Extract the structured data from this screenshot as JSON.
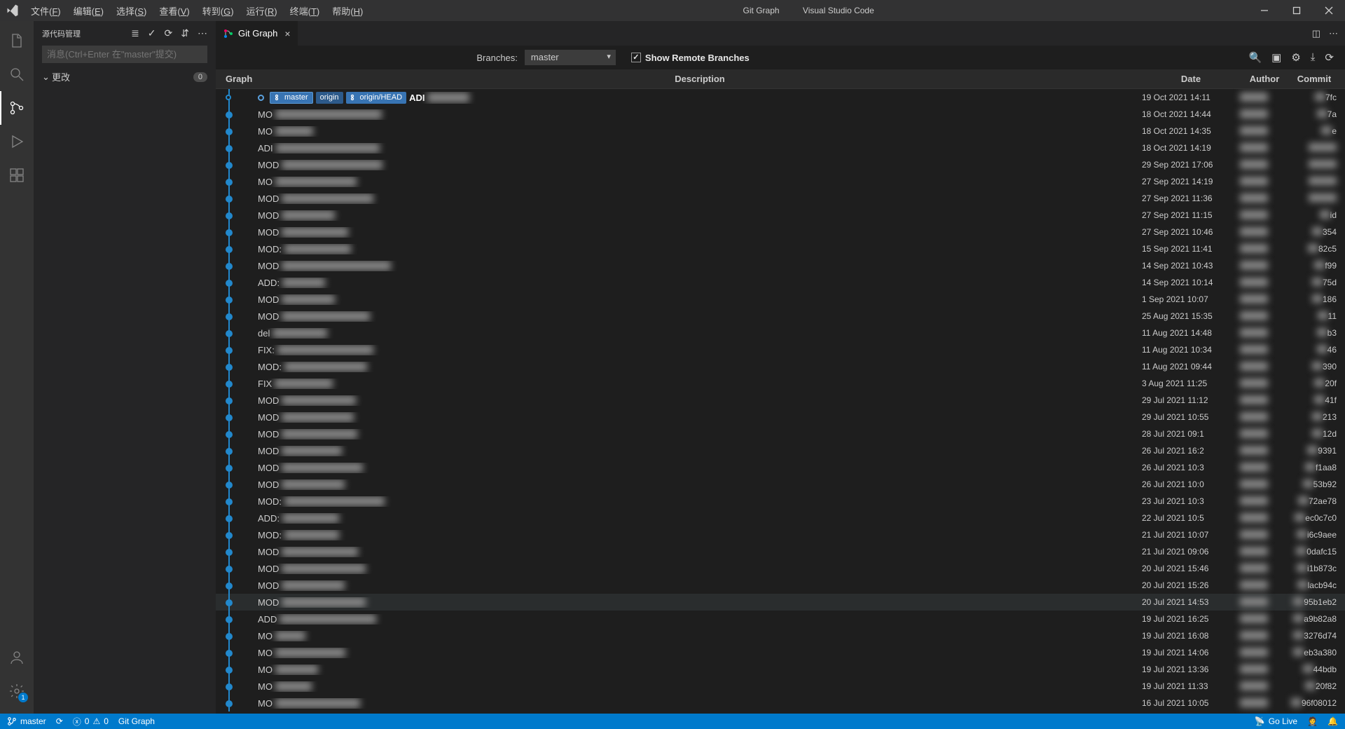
{
  "title": {
    "center": "Git Graph",
    "app": "Visual Studio Code"
  },
  "menu": [
    {
      "label": "文件",
      "key": "F"
    },
    {
      "label": "编辑",
      "key": "E"
    },
    {
      "label": "选择",
      "key": "S"
    },
    {
      "label": "查看",
      "key": "V"
    },
    {
      "label": "转到",
      "key": "G"
    },
    {
      "label": "运行",
      "key": "R"
    },
    {
      "label": "终端",
      "key": "T"
    },
    {
      "label": "帮助",
      "key": "H"
    }
  ],
  "sidebar": {
    "title": "源代码管理",
    "commit_placeholder": "消息(Ctrl+Enter 在\"master\"提交)",
    "changes_label": "更改",
    "changes_count": "0"
  },
  "tab": {
    "label": "Git Graph"
  },
  "toolbar": {
    "branches_label": "Branches:",
    "branch_value": "master",
    "show_remote": "Show Remote Branches",
    "show_remote_checked": true
  },
  "columns": {
    "graph": "Graph",
    "description": "Description",
    "date": "Date",
    "author": "Author",
    "commit": "Commit"
  },
  "refs": {
    "master": "master",
    "origin": "origin",
    "origin_head": "origin/HEAD"
  },
  "commits": [
    {
      "msg": "ADI",
      "bold": true,
      "date": "19 Oct 2021 14:11",
      "commit": "7fc",
      "head": true,
      "hollow": true
    },
    {
      "msg": "MO",
      "date": "18 Oct 2021 14:44",
      "commit": "7a"
    },
    {
      "msg": "MO",
      "date": "18 Oct 2021 14:35",
      "commit": "e"
    },
    {
      "msg": "ADI",
      "date": "18 Oct 2021 14:19",
      "commit": ""
    },
    {
      "msg": "MOD",
      "date": "29 Sep 2021 17:06",
      "commit": ""
    },
    {
      "msg": "MO",
      "date": "27 Sep 2021 14:19",
      "commit": ""
    },
    {
      "msg": "MOD",
      "date": "27 Sep 2021 11:36",
      "commit": ""
    },
    {
      "msg": "MOD",
      "date": "27 Sep 2021 11:15",
      "commit": "id"
    },
    {
      "msg": "MOD",
      "date": "27 Sep 2021 10:46",
      "commit": "354"
    },
    {
      "msg": "MOD:",
      "date": "15 Sep 2021 11:41",
      "commit": "82c5"
    },
    {
      "msg": "MOD",
      "date": "14 Sep 2021 10:43",
      "commit": "f99"
    },
    {
      "msg": "ADD:",
      "date": "14 Sep 2021 10:14",
      "commit": "75d"
    },
    {
      "msg": "MOD",
      "date": "1 Sep 2021 10:07",
      "commit": "186"
    },
    {
      "msg": "MOD",
      "date": "25 Aug 2021 15:35",
      "commit": "11"
    },
    {
      "msg": "del",
      "date": "11 Aug 2021 14:48",
      "commit": "b3"
    },
    {
      "msg": "FIX:",
      "date": "11 Aug 2021 10:34",
      "commit": "46"
    },
    {
      "msg": "MOD:",
      "date": "11 Aug 2021 09:44",
      "commit": "390"
    },
    {
      "msg": "FIX",
      "date": "3 Aug 2021 11:25",
      "commit": "20f"
    },
    {
      "msg": "MOD",
      "date": "29 Jul 2021 11:12",
      "commit": "41f"
    },
    {
      "msg": "MOD",
      "date": "29 Jul 2021 10:55",
      "commit": "213"
    },
    {
      "msg": "MOD",
      "date": "28 Jul 2021 09:1",
      "commit": "12d"
    },
    {
      "msg": "MOD",
      "date": "26 Jul 2021 16:2",
      "commit": "9391"
    },
    {
      "msg": "MOD",
      "date": "26 Jul 2021 10:3",
      "commit": "f1aa8"
    },
    {
      "msg": "MOD",
      "date": "26 Jul 2021 10:0",
      "commit": "53b92"
    },
    {
      "msg": "MOD:",
      "date": "23 Jul 2021 10:3",
      "commit": "72ae78"
    },
    {
      "msg": "ADD:",
      "date": "22 Jul 2021 10:5",
      "commit": "ec0c7c0"
    },
    {
      "msg": "MOD:",
      "date": "21 Jul 2021 10:07",
      "commit": "i6c9aee"
    },
    {
      "msg": "MOD",
      "date": "21 Jul 2021 09:06",
      "commit": "0dafc15"
    },
    {
      "msg": "MOD",
      "date": "20 Jul 2021 15:46",
      "commit": "i1b873c"
    },
    {
      "msg": "MOD",
      "date": "20 Jul 2021 15:26",
      "commit": "lacb94c"
    },
    {
      "msg": "MOD",
      "date": "20 Jul 2021 14:53",
      "commit": "95b1eb2",
      "hovered": true
    },
    {
      "msg": "ADD",
      "date": "19 Jul 2021 16:25",
      "commit": "a9b82a8"
    },
    {
      "msg": "MO",
      "date": "19 Jul 2021 16:08",
      "commit": "3276d74"
    },
    {
      "msg": "MO",
      "date": "19 Jul 2021 14:06",
      "commit": "eb3a380"
    },
    {
      "msg": "MO",
      "date": "19 Jul 2021 13:36",
      "commit": "44bdb"
    },
    {
      "msg": "MO",
      "date": "19 Jul 2021 11:33",
      "commit": "20f82"
    },
    {
      "msg": "MO",
      "date": "16 Jul 2021 10:05",
      "commit": "96f08012"
    }
  ],
  "status": {
    "branch": "master",
    "errors": "0",
    "warnings": "0",
    "gitgraph": "Git Graph",
    "golive": "Go Live"
  }
}
